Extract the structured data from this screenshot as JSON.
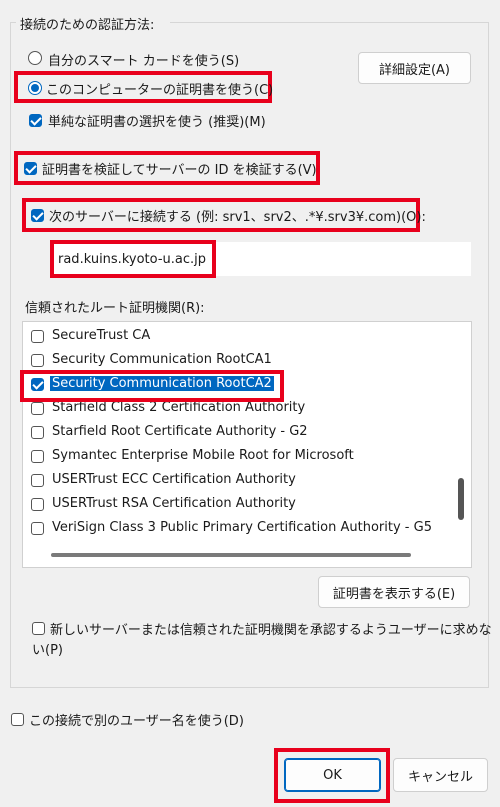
{
  "group_title": "接続のための認証方法:",
  "auth": {
    "smartcard_label": "自分のスマート カードを使う(S)",
    "certificate_label": "このコンピューターの証明書を使う(C)",
    "simple_select_label": "単純な証明書の選択を使う (推奨)(M)",
    "advanced_button": "詳細設定(A)"
  },
  "verify_server_label": "証明書を検証してサーバーの ID を検証する(V)",
  "connect_servers_label": "次のサーバーに接続する (例: srv1、srv2、.*¥.srv3¥.com)(O):",
  "server_value": "rad.kuins.kyoto-u.ac.jp",
  "trusted_root_label": "信頼されたルート証明機関(R):",
  "ca_list": [
    {
      "label": "SecureTrust CA",
      "checked": false,
      "selected": false
    },
    {
      "label": "Security Communication RootCA1",
      "checked": false,
      "selected": false
    },
    {
      "label": "Security Communication RootCA2",
      "checked": true,
      "selected": true
    },
    {
      "label": "Starfield Class 2 Certification Authority",
      "checked": false,
      "selected": false
    },
    {
      "label": "Starfield Root Certificate Authority - G2",
      "checked": false,
      "selected": false
    },
    {
      "label": "Symantec Enterprise Mobile Root for Microsoft",
      "checked": false,
      "selected": false
    },
    {
      "label": "USERTrust ECC Certification Authority",
      "checked": false,
      "selected": false
    },
    {
      "label": "USERTrust RSA Certification Authority",
      "checked": false,
      "selected": false
    },
    {
      "label": "VeriSign Class 3 Public Primary Certification Authority - G5",
      "checked": false,
      "selected": false
    }
  ],
  "view_cert_button": "証明書を表示する(E)",
  "prompt_label_line1": "新しいサーバーまたは信頼された証明機関を承認するようユーザーに求めな",
  "prompt_label_line2": "い(P)",
  "alt_username_label": "この接続で別のユーザー名を使う(D)",
  "ok_button": "OK",
  "cancel_button": "キャンセル",
  "colors": {
    "accent": "#0067c0",
    "highlight": "#e8001c"
  }
}
